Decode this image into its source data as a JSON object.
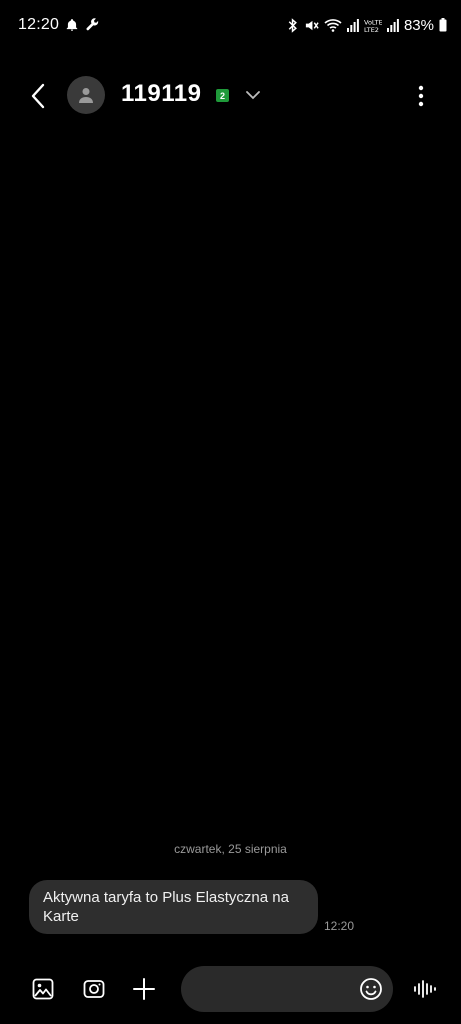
{
  "status_bar": {
    "time": "12:20",
    "battery": "83%",
    "left_icons": [
      "bell-icon",
      "wrench-icon"
    ],
    "right_icons": [
      "bluetooth-icon",
      "mute-icon",
      "wifi-icon",
      "signal-icon",
      "volte-lte2-icon",
      "signal-icon",
      "battery-icon"
    ]
  },
  "header": {
    "contact": "119119",
    "sim_badge": "2",
    "icons": [
      "back-icon",
      "person-icon",
      "chevron-down-icon",
      "more-vert-icon"
    ]
  },
  "conversation": {
    "date_label": "czwartek, 25 sierpnia",
    "messages": [
      {
        "text": "Aktywna taryfa to Plus Elastyczna na Karte",
        "time": "12:20",
        "direction": "incoming"
      }
    ]
  },
  "composer": {
    "input_value": "",
    "input_placeholder": "",
    "icons": [
      "gallery-icon",
      "camera-icon",
      "plus-icon",
      "emoji-icon",
      "voice-icon"
    ]
  },
  "colors": {
    "background": "#000000",
    "bubble": "#2e2e2e",
    "input": "#2a2a2a",
    "sim_badge": "#1f9a3a",
    "secondary_text": "#9a9a9a"
  }
}
